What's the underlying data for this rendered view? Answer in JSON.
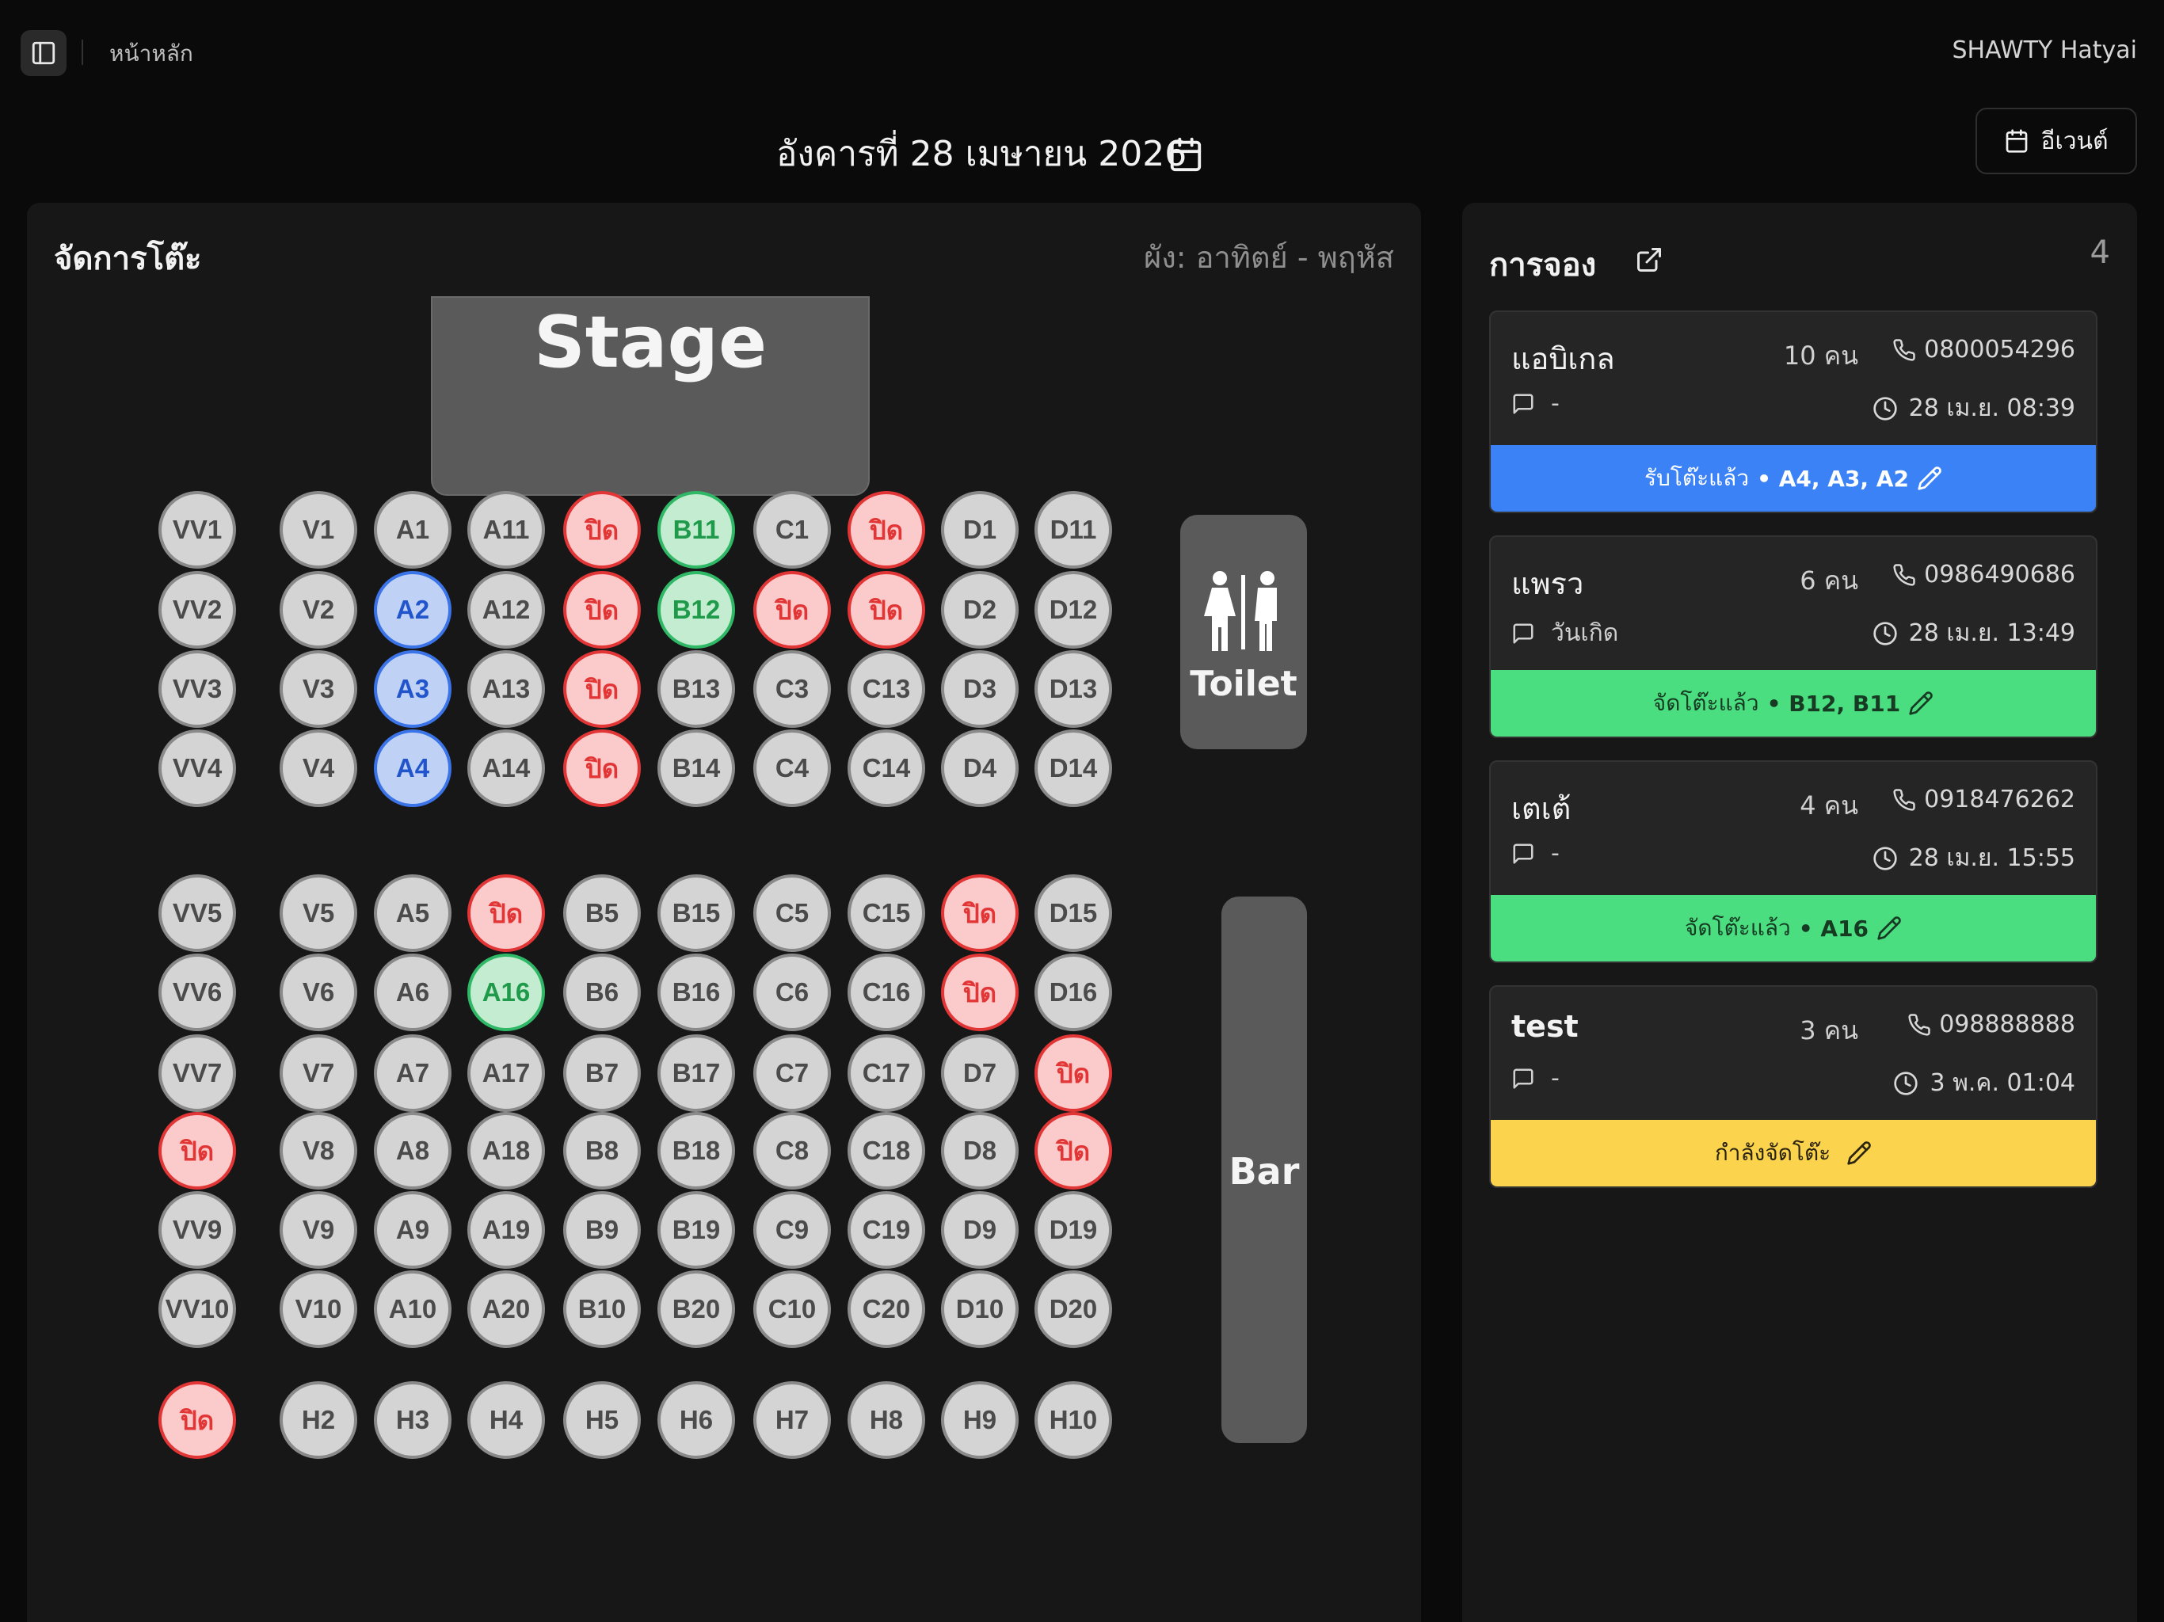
{
  "header": {
    "breadcrumb": "หน้าหลัก",
    "venue": "SHAWTY Hatyai",
    "date": "อังคารที่ 28 เมษายน 2026",
    "event_button": "อีเวนต์"
  },
  "tables_panel": {
    "title": "จัดการโต๊ะ",
    "layout": "ผัง: อาทิตย์ - พฤหัส",
    "stage_label": "Stage",
    "toilet_label": "Toilet",
    "bar_label": "Bar",
    "status_colors": {
      "available": "#d4d4d4",
      "closed": "#fbcaca",
      "reserved": "#bfd2f6",
      "seated": "#c3ecd0"
    },
    "seat_rows": [
      [
        "VV1",
        "V1",
        "A1",
        "A11",
        "ปิด",
        "B11",
        "C1",
        "ปิด",
        "D1",
        "D11"
      ],
      [
        "VV2",
        "V2",
        "A2",
        "A12",
        "ปิด",
        "B12",
        "ปิด",
        "ปิด",
        "D2",
        "D12"
      ],
      [
        "VV3",
        "V3",
        "A3",
        "A13",
        "ปิด",
        "B13",
        "C3",
        "C13",
        "D3",
        "D13"
      ],
      [
        "VV4",
        "V4",
        "A4",
        "A14",
        "ปิด",
        "B14",
        "C4",
        "C14",
        "D4",
        "D14"
      ],
      [
        "VV5",
        "V5",
        "A5",
        "ปิด",
        "B5",
        "B15",
        "C5",
        "C15",
        "ปิด",
        "D15"
      ],
      [
        "VV6",
        "V6",
        "A6",
        "A16",
        "B6",
        "B16",
        "C6",
        "C16",
        "ปิด",
        "D16"
      ],
      [
        "VV7",
        "V7",
        "A7",
        "A17",
        "B7",
        "B17",
        "C7",
        "C17",
        "D7",
        "ปิด"
      ],
      [
        "ปิด",
        "V8",
        "A8",
        "A18",
        "B8",
        "B18",
        "C8",
        "C18",
        "D8",
        "ปิด"
      ],
      [
        "VV9",
        "V9",
        "A9",
        "A19",
        "B9",
        "B19",
        "C9",
        "C19",
        "D9",
        "D19"
      ],
      [
        "VV10",
        "V10",
        "A10",
        "A20",
        "B10",
        "B20",
        "C10",
        "C20",
        "D10",
        "D20"
      ],
      [
        "ปิด",
        "H2",
        "H3",
        "H4",
        "H5",
        "H6",
        "H7",
        "H8",
        "H9",
        "H10"
      ]
    ],
    "seat_status": [
      [
        "available",
        "available",
        "available",
        "available",
        "closed",
        "seated",
        "available",
        "closed",
        "available",
        "available"
      ],
      [
        "available",
        "available",
        "reserved",
        "available",
        "closed",
        "seated",
        "closed",
        "closed",
        "available",
        "available"
      ],
      [
        "available",
        "available",
        "reserved",
        "available",
        "closed",
        "available",
        "available",
        "available",
        "available",
        "available"
      ],
      [
        "available",
        "available",
        "reserved",
        "available",
        "closed",
        "available",
        "available",
        "available",
        "available",
        "available"
      ],
      [
        "available",
        "available",
        "available",
        "closed",
        "available",
        "available",
        "available",
        "available",
        "closed",
        "available"
      ],
      [
        "available",
        "available",
        "available",
        "seated",
        "available",
        "available",
        "available",
        "available",
        "closed",
        "available"
      ],
      [
        "available",
        "available",
        "available",
        "available",
        "available",
        "available",
        "available",
        "available",
        "available",
        "closed"
      ],
      [
        "closed",
        "available",
        "available",
        "available",
        "available",
        "available",
        "available",
        "available",
        "available",
        "closed"
      ],
      [
        "available",
        "available",
        "available",
        "available",
        "available",
        "available",
        "available",
        "available",
        "available",
        "available"
      ],
      [
        "available",
        "available",
        "available",
        "available",
        "available",
        "available",
        "available",
        "available",
        "available",
        "available"
      ],
      [
        "closed",
        "available",
        "available",
        "available",
        "available",
        "available",
        "available",
        "available",
        "available",
        "available"
      ]
    ]
  },
  "reservations": {
    "title": "การจอง",
    "count": "4",
    "items": [
      {
        "name": "แอบิเกล",
        "people": "10 คน",
        "phone": "0800054296",
        "note": "-",
        "time": "28 เม.ย. 08:39",
        "status_label": "รับโต๊ะแล้ว",
        "tables": "• A4, A3, A2",
        "status_color": "#3b82f6"
      },
      {
        "name": "แพรว",
        "people": "6 คน",
        "phone": "0986490686",
        "note": "วันเกิด",
        "time": "28 เม.ย. 13:49",
        "status_label": "จัดโต๊ะแล้ว",
        "tables": "• B12, B11",
        "status_color": "#4ade80"
      },
      {
        "name": "เตเต้",
        "people": "4 คน",
        "phone": "0918476262",
        "note": "-",
        "time": "28 เม.ย. 15:55",
        "status_label": "จัดโต๊ะแล้ว",
        "tables": "• A16",
        "status_color": "#4ade80"
      },
      {
        "name": "test",
        "people": "3 คน",
        "phone": "098888888",
        "note": "-",
        "time": "3 พ.ค. 01:04",
        "status_label": "กำลังจัดโต๊ะ",
        "tables": "",
        "status_color": "#fcd34d"
      }
    ]
  }
}
